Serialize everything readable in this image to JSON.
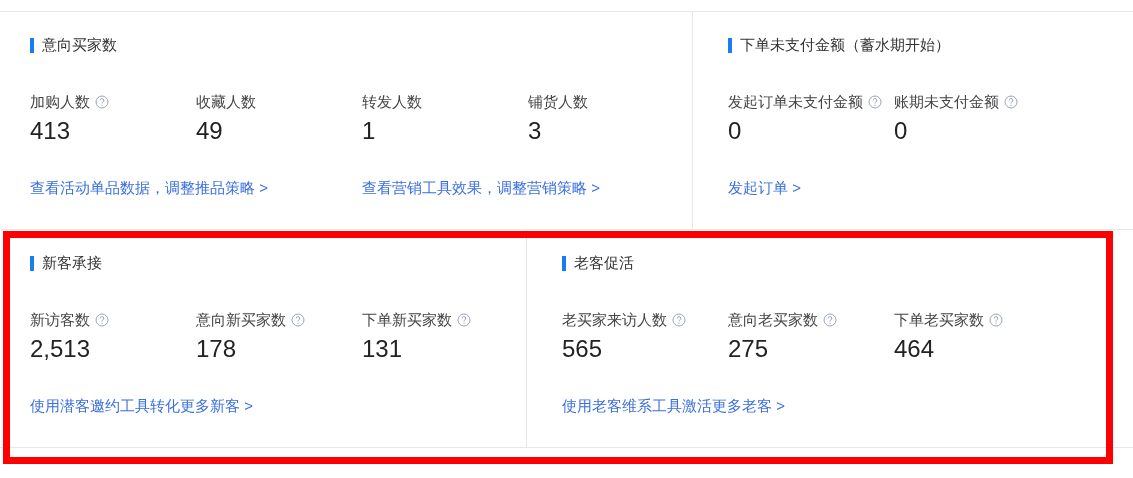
{
  "rows": [
    {
      "highlighted": false,
      "panels": [
        {
          "title": "意向买家数",
          "metrics": [
            {
              "label": "加购人数",
              "help": true,
              "value": "413"
            },
            {
              "label": "收藏人数",
              "help": false,
              "value": "49"
            },
            {
              "label": "转发人数",
              "help": false,
              "value": "1"
            },
            {
              "label": "铺货人数",
              "help": false,
              "value": "3"
            }
          ],
          "links": [
            "查看活动单品数据，调整推品策略 >",
            "查看营销工具效果，调整营销策略 >"
          ]
        },
        {
          "title": "下单未支付金额（蓄水期开始）",
          "metrics": [
            {
              "label": "发起订单未支付金额",
              "help": true,
              "value": "0"
            },
            {
              "label": "账期未支付金额",
              "help": true,
              "value": "0"
            }
          ],
          "links": [
            "发起订单 >"
          ]
        }
      ]
    },
    {
      "highlighted": true,
      "panels": [
        {
          "title": "新客承接",
          "metrics": [
            {
              "label": "新访客数",
              "help": true,
              "value": "2,513"
            },
            {
              "label": "意向新买家数",
              "help": true,
              "value": "178"
            },
            {
              "label": "下单新买家数",
              "help": true,
              "value": "131"
            }
          ],
          "links": [
            "使用潜客邀约工具转化更多新客 >"
          ]
        },
        {
          "title": "老客促活",
          "metrics": [
            {
              "label": "老买家来访人数",
              "help": true,
              "value": "565"
            },
            {
              "label": "意向老买家数",
              "help": true,
              "value": "275"
            },
            {
              "label": "下单老买家数",
              "help": true,
              "value": "464"
            }
          ],
          "links": [
            "使用老客维系工具激活更多老客 >"
          ]
        }
      ]
    }
  ]
}
